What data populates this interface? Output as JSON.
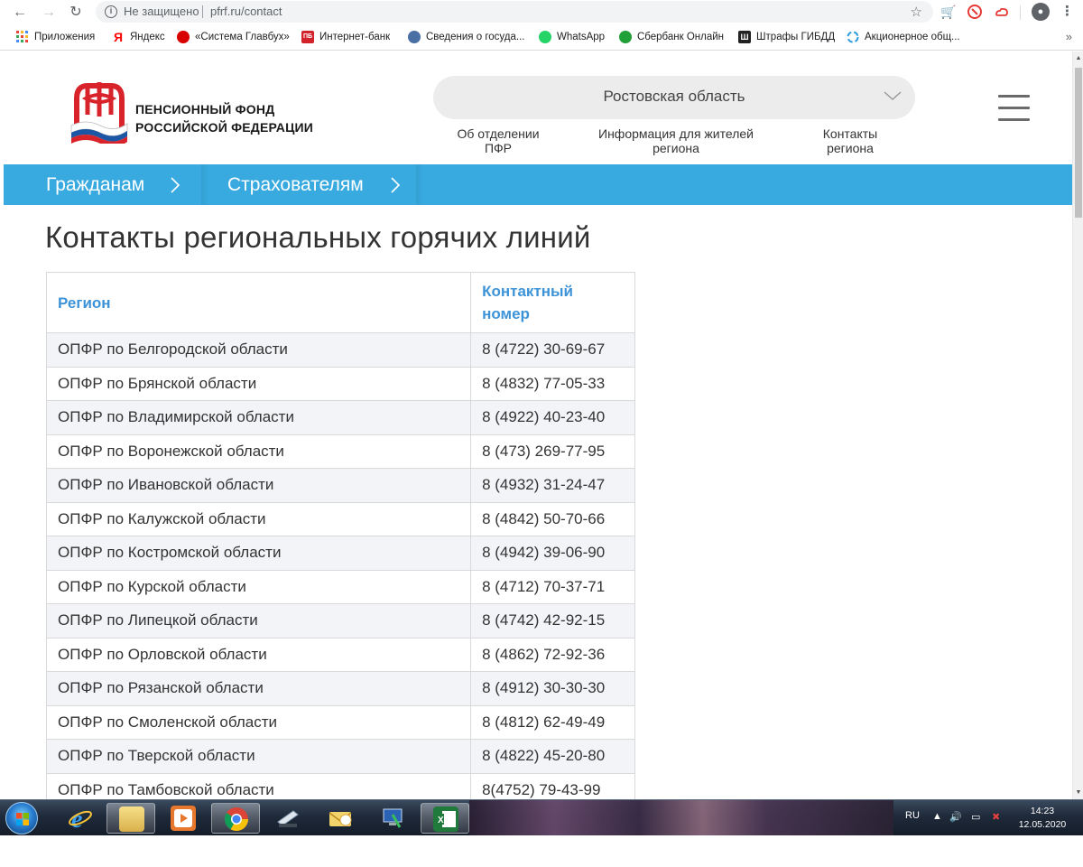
{
  "browser": {
    "security_label": "Не защищено",
    "url": "pfrf.ru/contact",
    "bookmarks": [
      {
        "label": "Приложения",
        "icon": "apps-grid-icon",
        "color": "#e8453c"
      },
      {
        "label": "Яндекс",
        "icon": "yandex-icon",
        "color": "#ff0000"
      },
      {
        "label": "«Система Главбух»",
        "icon": "glavbukh-icon",
        "color": "#d90000"
      },
      {
        "label": "Интернет-банк",
        "icon": "bank-icon",
        "color": "#d2232a"
      },
      {
        "label": "Сведения о госуда...",
        "icon": "emblem-icon",
        "color": "#4a6fa5"
      },
      {
        "label": "WhatsApp",
        "icon": "whatsapp-icon",
        "color": "#25d366"
      },
      {
        "label": "Сбербанк Онлайн",
        "icon": "sberbank-icon",
        "color": "#21a038"
      },
      {
        "label": "Штрафы ГИБДД",
        "icon": "fines-icon",
        "color": "#222222"
      },
      {
        "label": "Акционерное общ...",
        "icon": "company-icon",
        "color": "#2d9cdb"
      }
    ],
    "bookmarks_more": "»"
  },
  "header": {
    "brand_line1": "ПЕНСИОННЫЙ ФОНД",
    "brand_line2": "РОССИЙСКОЙ ФЕДЕРАЦИИ",
    "region_selected": "Ростовская область",
    "nav": [
      {
        "line1": "Об отделении",
        "line2": "ПФР"
      },
      {
        "line1": "Информация для жителей",
        "line2": "региона"
      },
      {
        "line1": "Контакты",
        "line2": "региона"
      }
    ]
  },
  "bluebar": {
    "tabs": [
      "Гражданам",
      "Страхователям"
    ]
  },
  "main": {
    "title": "Контакты региональных горячих линий",
    "table": {
      "headers": [
        "Регион",
        "Контактный номер"
      ],
      "rows": [
        [
          "ОПФР по Белгородской области",
          "8 (4722) 30-69-67"
        ],
        [
          "ОПФР по Брянской области",
          "8 (4832) 77-05-33"
        ],
        [
          "ОПФР по Владимирской области",
          "8 (4922) 40-23-40"
        ],
        [
          "ОПФР по Воронежской области",
          "8 (473) 269-77-95"
        ],
        [
          "ОПФР по Ивановской области",
          "8 (4932) 31-24-47"
        ],
        [
          "ОПФР по Калужской области",
          "8 (4842) 50-70-66"
        ],
        [
          "ОПФР по Костромской области",
          "8 (4942) 39-06-90"
        ],
        [
          "ОПФР по Курской области",
          "8 (4712) 70-37-71"
        ],
        [
          "ОПФР по Липецкой области",
          "8 (4742) 42-92-15"
        ],
        [
          "ОПФР по Орловской области",
          "8 (4862) 72-92-36"
        ],
        [
          "ОПФР по Рязанской области",
          "8 (4912) 30-30-30"
        ],
        [
          "ОПФР по Смоленской области",
          "8 (4812) 62-49-49"
        ],
        [
          "ОПФР по Тверской области",
          "8 (4822) 45-20-80"
        ],
        [
          "ОПФР по Тамбовской области",
          "8(4752) 79-43-99"
        ]
      ]
    }
  },
  "taskbar": {
    "lang": "RU",
    "time": "14:23",
    "date": "12.05.2020",
    "apps": [
      "ie-icon",
      "explorer-icon",
      "media-player-icon",
      "chrome-icon",
      "scanner-icon",
      "mail-icon",
      "network-icon",
      "excel-icon"
    ]
  },
  "colors": {
    "accent_blue": "#38aadf",
    "header_link_blue": "#3d93d8",
    "row_stripe": "#f3f4f7"
  }
}
